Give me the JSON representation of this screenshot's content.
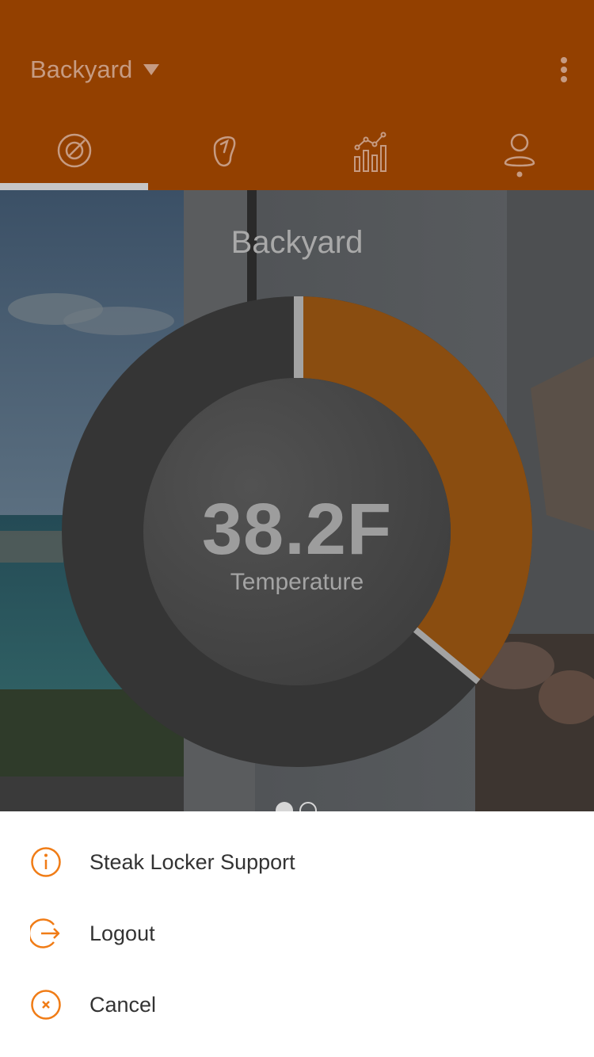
{
  "header": {
    "location_name": "Backyard",
    "tabs": [
      {
        "icon": "target-icon"
      },
      {
        "icon": "meat-cut-icon"
      },
      {
        "icon": "bar-chart-icon"
      },
      {
        "icon": "user-icon"
      }
    ],
    "selected_tab_index": 0
  },
  "main": {
    "title": "Backyard",
    "temperature": {
      "value": "38.2F",
      "label": "Temperature",
      "fill_fraction": 0.36
    },
    "page_dots": {
      "count": 2,
      "active_index": 0
    }
  },
  "action_sheet": {
    "items": [
      {
        "label": "Steak Locker Support",
        "icon": "info-icon"
      },
      {
        "label": "Logout",
        "icon": "logout-icon"
      },
      {
        "label": "Cancel",
        "icon": "close-icon"
      }
    ]
  },
  "colors": {
    "header": "#934000",
    "header_text": "#c69b82",
    "accent_orange": "#f07c16",
    "gauge_fill": "#8a4d10",
    "gauge_track": "#353535"
  }
}
